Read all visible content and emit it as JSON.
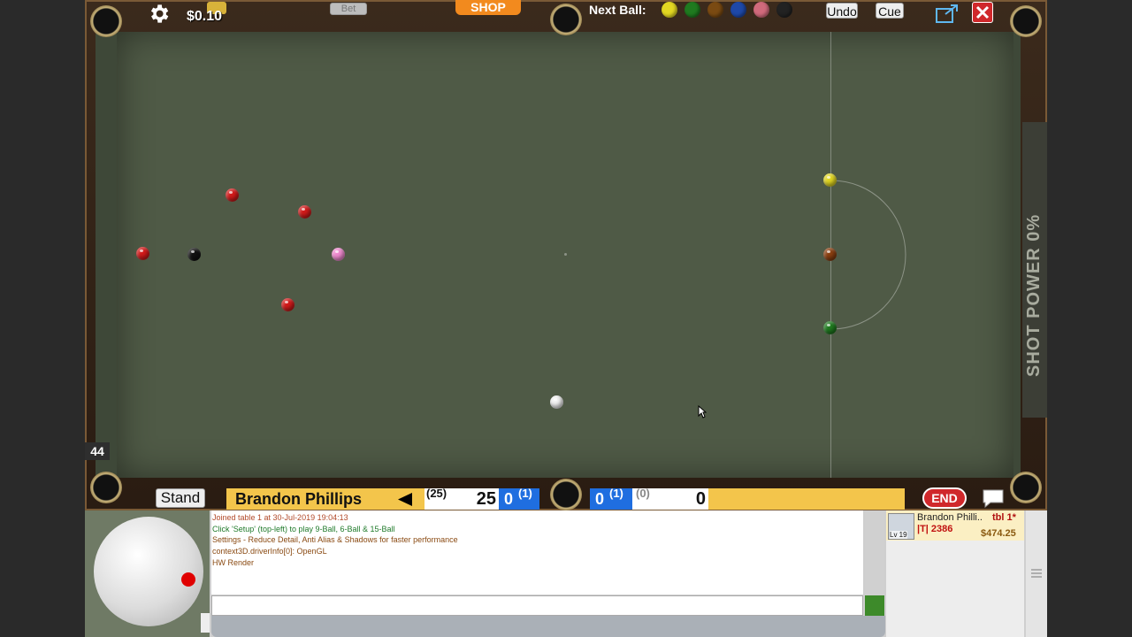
{
  "top": {
    "money": "$0.10",
    "bet_label": "Bet",
    "shop_label": "SHOP",
    "next_ball_label": "Next Ball:",
    "next_balls": [
      {
        "name": "yellow",
        "color": "#e2d722"
      },
      {
        "name": "green",
        "color": "#1f7a1f"
      },
      {
        "name": "brown",
        "color": "#7a4a12"
      },
      {
        "name": "blue",
        "color": "#1e48a8"
      },
      {
        "name": "pink",
        "color": "#d06a7c"
      },
      {
        "name": "black",
        "color": "#222222"
      }
    ],
    "undo_label": "Undo",
    "cue_label": "Cue"
  },
  "table": {
    "shot_count": "44",
    "shot_power_label": "SHOT POWER 0%"
  },
  "scoreline": {
    "stand_label": "Stand",
    "player1": {
      "name": "Brandon Phillips",
      "break_paren": "(25)",
      "score": "25",
      "frames": "0",
      "frames_paren": "(1)"
    },
    "player2": {
      "frames": "0",
      "frames_paren": "(1)",
      "break_paren": "(0)",
      "score": "0"
    },
    "end_label": "END"
  },
  "chat": {
    "lines": [
      {
        "text": "Joined table 1 at 30-Jul-2019 19:04:13",
        "color": "#b24a2a"
      },
      {
        "text": "Click 'Setup' (top-left) to play 9-Ball, 6-Ball & 15-Ball",
        "color": "#1f7a2a"
      },
      {
        "text": "Settings - Reduce Detail, Anti Alias & Shadows for faster performance",
        "color": "#8a4a12"
      },
      {
        "text": "context3D.driverInfo[0]: OpenGL",
        "color": "#8a4a12"
      },
      {
        "text": "HW Render",
        "color": "#8a4a12"
      }
    ]
  },
  "player_card": {
    "name": "Brandon Philli..",
    "table": "tbl 1*",
    "rank": "|T| 2386",
    "money": "$474.25",
    "level": "Lv 19"
  },
  "colors": {
    "felt": "#4f5a46",
    "red": "#d21a1a",
    "yellow": "#e2d722",
    "brown": "#8a3f10",
    "green": "#1f7a1f",
    "pink": "#f08ad0",
    "black": "#111111",
    "white": "#f2f2f2"
  }
}
